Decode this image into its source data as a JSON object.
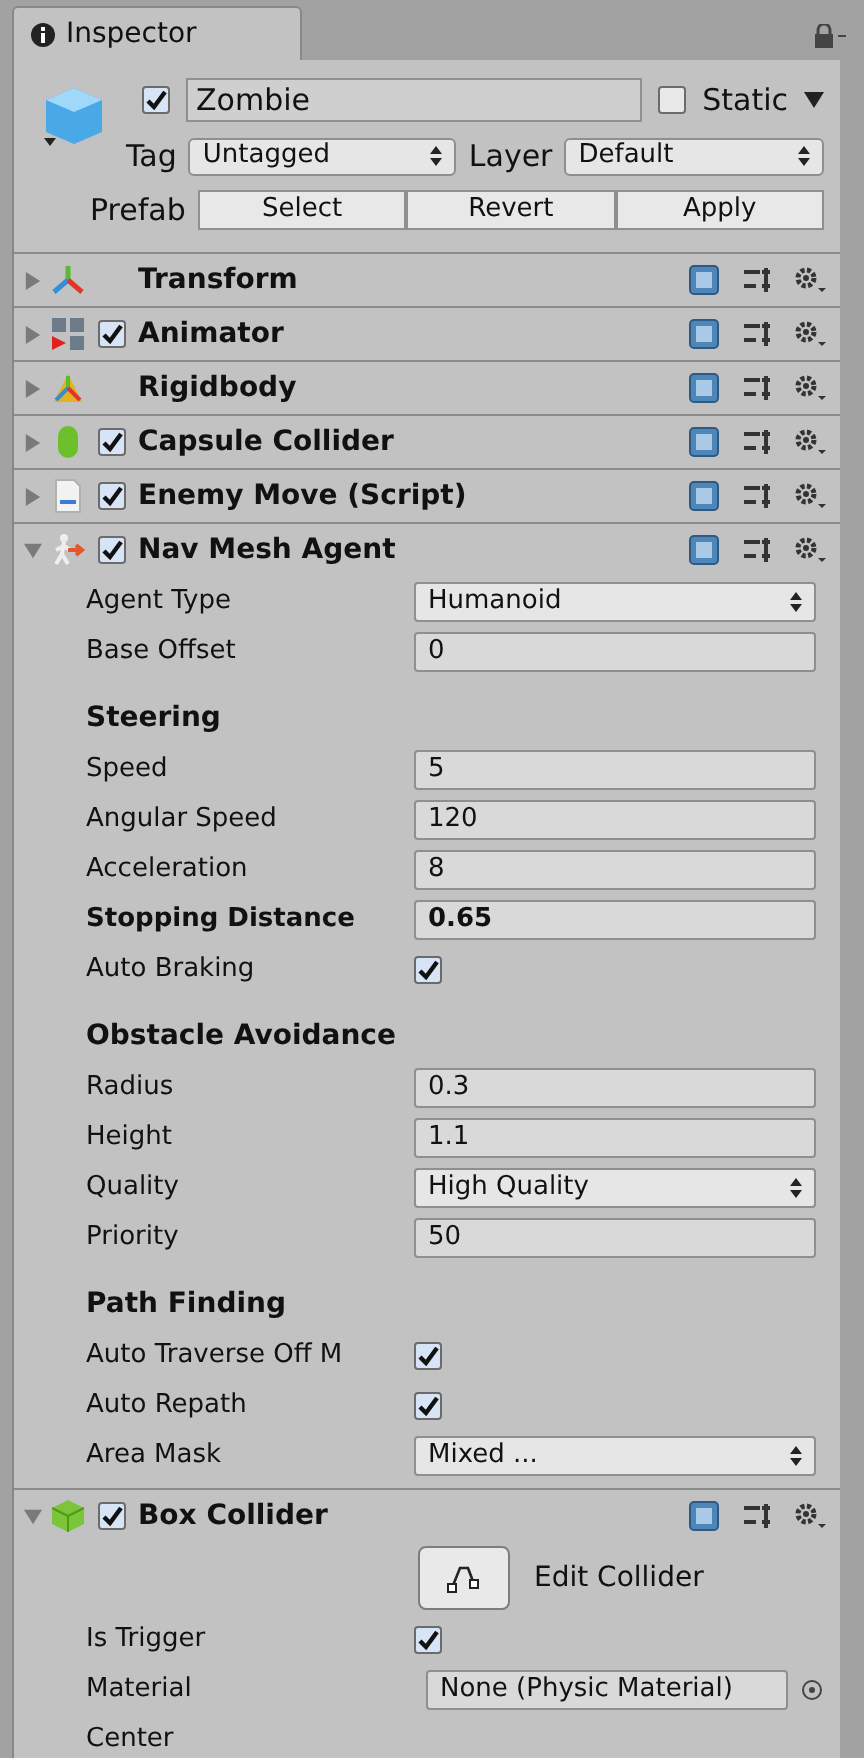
{
  "tab": {
    "title": "Inspector"
  },
  "object": {
    "active": true,
    "name": "Zombie",
    "static": false,
    "static_label": "Static",
    "tag_label": "Tag",
    "tag": "Untagged",
    "layer_label": "Layer",
    "layer": "Default",
    "prefab_label": "Prefab",
    "prefab_buttons": [
      "Select",
      "Revert",
      "Apply"
    ]
  },
  "components": [
    {
      "name": "Transform",
      "kind": "transform",
      "expanded": false
    },
    {
      "name": "Animator",
      "kind": "animator",
      "enabled": true,
      "expanded": false
    },
    {
      "name": "Rigidbody",
      "kind": "rigidbody",
      "expanded": false
    },
    {
      "name": "Capsule Collider",
      "kind": "capsule",
      "enabled": true,
      "expanded": false
    },
    {
      "name": "Enemy Move (Script)",
      "kind": "script",
      "enabled": true,
      "expanded": false
    },
    {
      "name": "Nav Mesh Agent",
      "kind": "agent",
      "enabled": true,
      "expanded": true,
      "fields": [
        {
          "kind": "dropdown",
          "label": "Agent Type",
          "value": "Humanoid",
          "modified": false
        },
        {
          "kind": "text",
          "label": "Base Offset",
          "value": "0",
          "modified": false
        },
        {
          "kind": "section",
          "label": "Steering"
        },
        {
          "kind": "text",
          "label": "Speed",
          "value": "5",
          "modified": false
        },
        {
          "kind": "text",
          "label": "Angular Speed",
          "value": "120",
          "modified": false
        },
        {
          "kind": "text",
          "label": "Acceleration",
          "value": "8",
          "modified": false
        },
        {
          "kind": "text",
          "label": "Stopping Distance",
          "value": "0.65",
          "modified": true
        },
        {
          "kind": "checkbox",
          "label": "Auto Braking",
          "checked": true,
          "modified": false
        },
        {
          "kind": "section",
          "label": "Obstacle Avoidance"
        },
        {
          "kind": "text",
          "label": "Radius",
          "value": "0.3",
          "modified": false
        },
        {
          "kind": "text",
          "label": "Height",
          "value": "1.1",
          "modified": false
        },
        {
          "kind": "dropdown",
          "label": "Quality",
          "value": "High Quality",
          "modified": false
        },
        {
          "kind": "text",
          "label": "Priority",
          "value": "50",
          "modified": false
        },
        {
          "kind": "section",
          "label": "Path Finding"
        },
        {
          "kind": "checkbox",
          "label": "Auto Traverse Off M",
          "checked": true,
          "modified": false
        },
        {
          "kind": "checkbox",
          "label": "Auto Repath",
          "checked": true,
          "modified": false
        },
        {
          "kind": "dropdown",
          "label": "Area Mask",
          "value": "Mixed ...",
          "modified": false
        }
      ]
    },
    {
      "name": "Box Collider",
      "kind": "box",
      "enabled": true,
      "expanded": true,
      "fields": [
        {
          "kind": "button",
          "value": "Edit Collider"
        },
        {
          "kind": "checkbox",
          "label": "Is Trigger",
          "checked": true,
          "modified": false
        },
        {
          "kind": "object",
          "label": "Material",
          "value": "None (Physic Material)",
          "modified": false
        },
        {
          "kind": "label",
          "label": "Center"
        }
      ]
    }
  ]
}
